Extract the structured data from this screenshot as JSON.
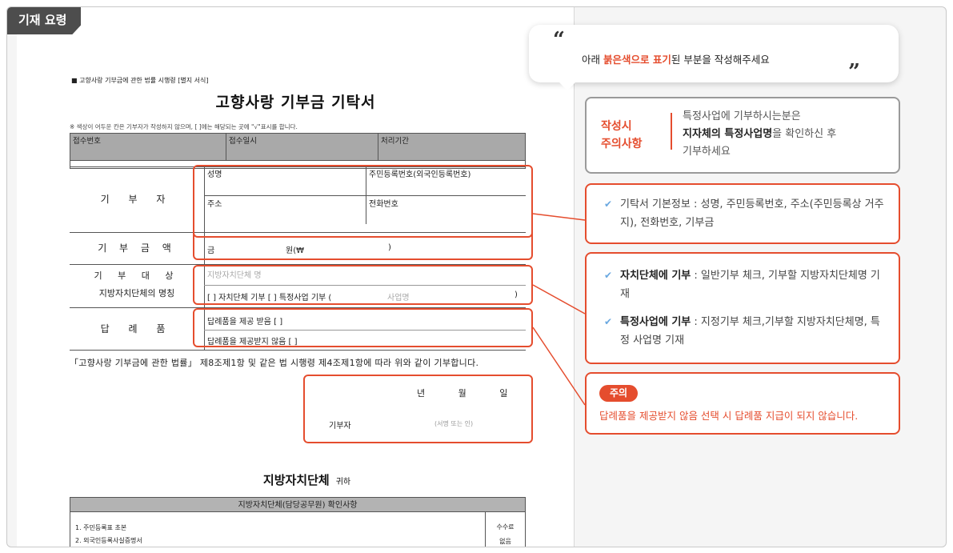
{
  "tab_label": "기재 요령",
  "document": {
    "law_ref": "■ 고향사랑 기부금에 관한 법률 시행령 [별지 서식]",
    "title": "고향사랑 기부금 기탁서",
    "note": "※ 색상이 어두운 칸은 기부자가 작성하지 않으며, [ ]에는 해당되는 곳에 \"√\"표시를 합니다.",
    "reception": [
      "접수번호",
      "접수일시",
      "처리기간"
    ],
    "donor_label": "기  부  자",
    "name_label": "성명",
    "id_label": "주민등록번호(외국인등록번호)",
    "address_label": "주소",
    "phone_label": "전화번호",
    "amount_label": "기 부 금 액",
    "amount_prefix": "금",
    "amount_unit": "원(₩",
    "amount_close": ")",
    "target_label_1": "기  부  대  상",
    "target_label_2": "지방자치단체의 명칭",
    "target_placeholder": "지방자치단체 명",
    "target_options": "[ ] 자치단체 기부    [ ] 특정사업 기부 (",
    "business_placeholder": "사업명",
    "target_close": ")",
    "gift_label": "답   례   품",
    "gift_yes": "답례품을 제공 받음 [ ]",
    "gift_no": "답례품을 제공받지 않음 [ ]",
    "declaration": "「고향사랑 기부금에 관한 법률」 제8조제1항 및 같은 법 시행령 제4조제1항에 따라 위와 같이 기부합니다.",
    "date_year": "년",
    "date_month": "월",
    "date_day": "일",
    "signer_label": "기부자",
    "sign_hint": "(서명 또는 인)",
    "recipient": "지방자치단체",
    "recipient_suffix": "귀하",
    "confirm_header": "지방자치단체(담당공무원) 확인사항",
    "confirm_items": [
      "1. 주민등록표 초본",
      "2. 외국인등록사실증명서"
    ],
    "fee_label": "수수료",
    "fee_value": "없음"
  },
  "guide": {
    "bubble_prefix": "아래 ",
    "bubble_highlight": "붉은색으로 표기",
    "bubble_suffix": "된 부분을 작성해주세요",
    "caution_title_1": "작성시",
    "caution_title_2": "주의사항",
    "caution_line_1": "특정사업에 기부하시는분은",
    "caution_bold": "지자체의 특정사업명",
    "caution_line_2_rest": "을 확인하신 후",
    "caution_line_3": "기부하세요",
    "basic_info": "기탁서 기본정보 : 성명, 주민등록번호, 주소(주민등록상 거주지), 전화번호, 기부금",
    "target_1_bold": "자치단체에 기부",
    "target_1_text": " : 일반기부 체크, 기부할 지방자치단체명 기재",
    "target_2_bold": "특정사업에 기부",
    "target_2_text": " : 지정기부 체크,기부할 지방자치단체명, 특정 사업명 기재",
    "warn_badge": "주의",
    "warn_text": "답례품을 제공받지 않음 선택 시 답례품 지급이 되지 않습니다."
  },
  "colors": {
    "accent": "#e54d2e",
    "card_border": "#9a9a9a",
    "tab_bg": "#4d4d4d"
  }
}
